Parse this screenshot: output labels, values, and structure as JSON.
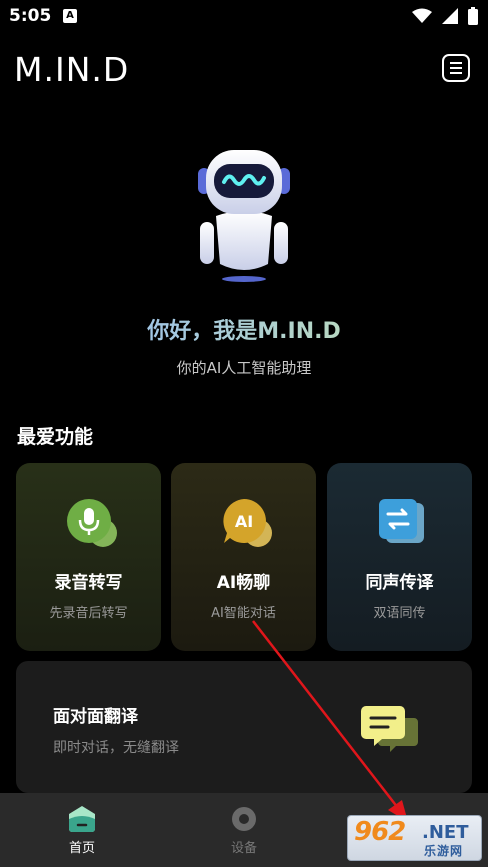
{
  "status_bar": {
    "time": "5:05",
    "notification_glyph": "A"
  },
  "header": {
    "brand": "M.IN.D",
    "menu_icon": "menu-icon"
  },
  "hero": {
    "greeting": "你好，我是M.IN.D",
    "subtitle": "你的AI人工智能助理"
  },
  "favorites": {
    "title": "最爱功能",
    "cards": [
      {
        "title": "录音转写",
        "subtitle": "先录音后转写",
        "icon": "microphone-icon",
        "accent": "#7fbf4d"
      },
      {
        "title": "AI畅聊",
        "subtitle": "AI智能对话",
        "icon": "ai-chat-icon",
        "accent": "#e0b63a"
      },
      {
        "title": "同声传译",
        "subtitle": "双语同传",
        "icon": "interpretation-icon",
        "accent": "#4aa8e0"
      }
    ],
    "wide_card": {
      "title": "面对面翻译",
      "subtitle": "即时对话，无缝翻译",
      "icon": "face-to-face-chat-icon",
      "accent": "#f2ef8a"
    }
  },
  "tab_bar": {
    "tabs": [
      {
        "label": "首页",
        "icon": "home-icon",
        "active": true
      },
      {
        "label": "设备",
        "icon": "device-icon",
        "active": false
      }
    ]
  },
  "watermark": {
    "main": "962",
    "net": ".NET",
    "sub": "乐游网"
  },
  "colors": {
    "background": "#000000",
    "tab_bar": "#2a2a2a",
    "arrow": "#e0161b"
  }
}
